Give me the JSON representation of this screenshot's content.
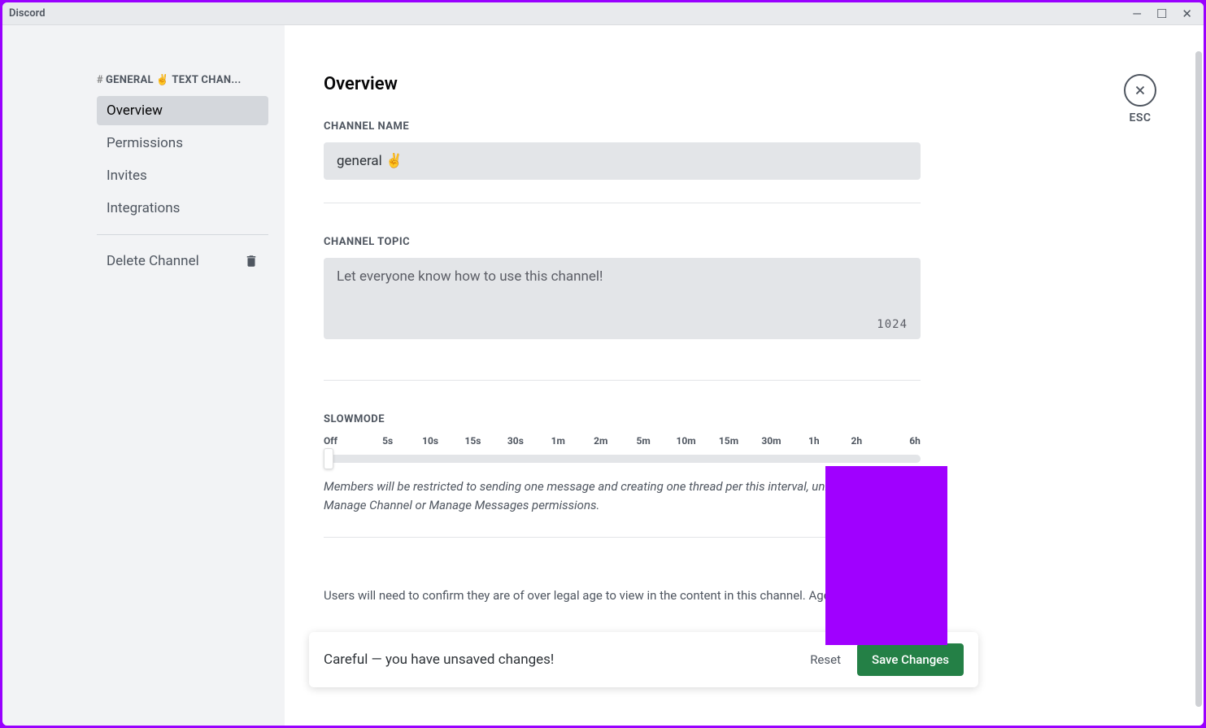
{
  "window": {
    "title": "Discord"
  },
  "sidebar": {
    "header_prefix": "#",
    "header_channel": "GENERAL",
    "header_emoji": "✌",
    "header_suffix": "TEXT CHAN...",
    "items": [
      {
        "label": "Overview",
        "active": true
      },
      {
        "label": "Permissions",
        "active": false
      },
      {
        "label": "Invites",
        "active": false
      },
      {
        "label": "Integrations",
        "active": false
      }
    ],
    "delete_label": "Delete Channel"
  },
  "close": {
    "label": "ESC"
  },
  "page": {
    "title": "Overview"
  },
  "channel_name": {
    "label": "CHANNEL NAME",
    "value": "general ✌"
  },
  "channel_topic": {
    "label": "CHANNEL TOPIC",
    "placeholder": "Let everyone know how to use this channel!",
    "value": "",
    "char_limit": "1024"
  },
  "slowmode": {
    "label": "SLOWMODE",
    "ticks": [
      "Off",
      "5s",
      "10s",
      "15s",
      "30s",
      "1m",
      "2m",
      "5m",
      "10m",
      "15m",
      "30m",
      "1h",
      "2h",
      "6h"
    ],
    "help": "Members will be restricted to sending one message and creating one thread per this interval, unless they have Manage Channel or Manage Messages permissions."
  },
  "age_restricted": {
    "desc_partial": "Users will need to confirm they are of over legal age to view in the content in this channel. Age-restricted"
  },
  "unsaved": {
    "message": "Careful — you have unsaved changes!",
    "reset": "Reset",
    "save": "Save Changes"
  },
  "colors": {
    "accent_green": "#248046",
    "annotation_purple": "#a000ff"
  }
}
